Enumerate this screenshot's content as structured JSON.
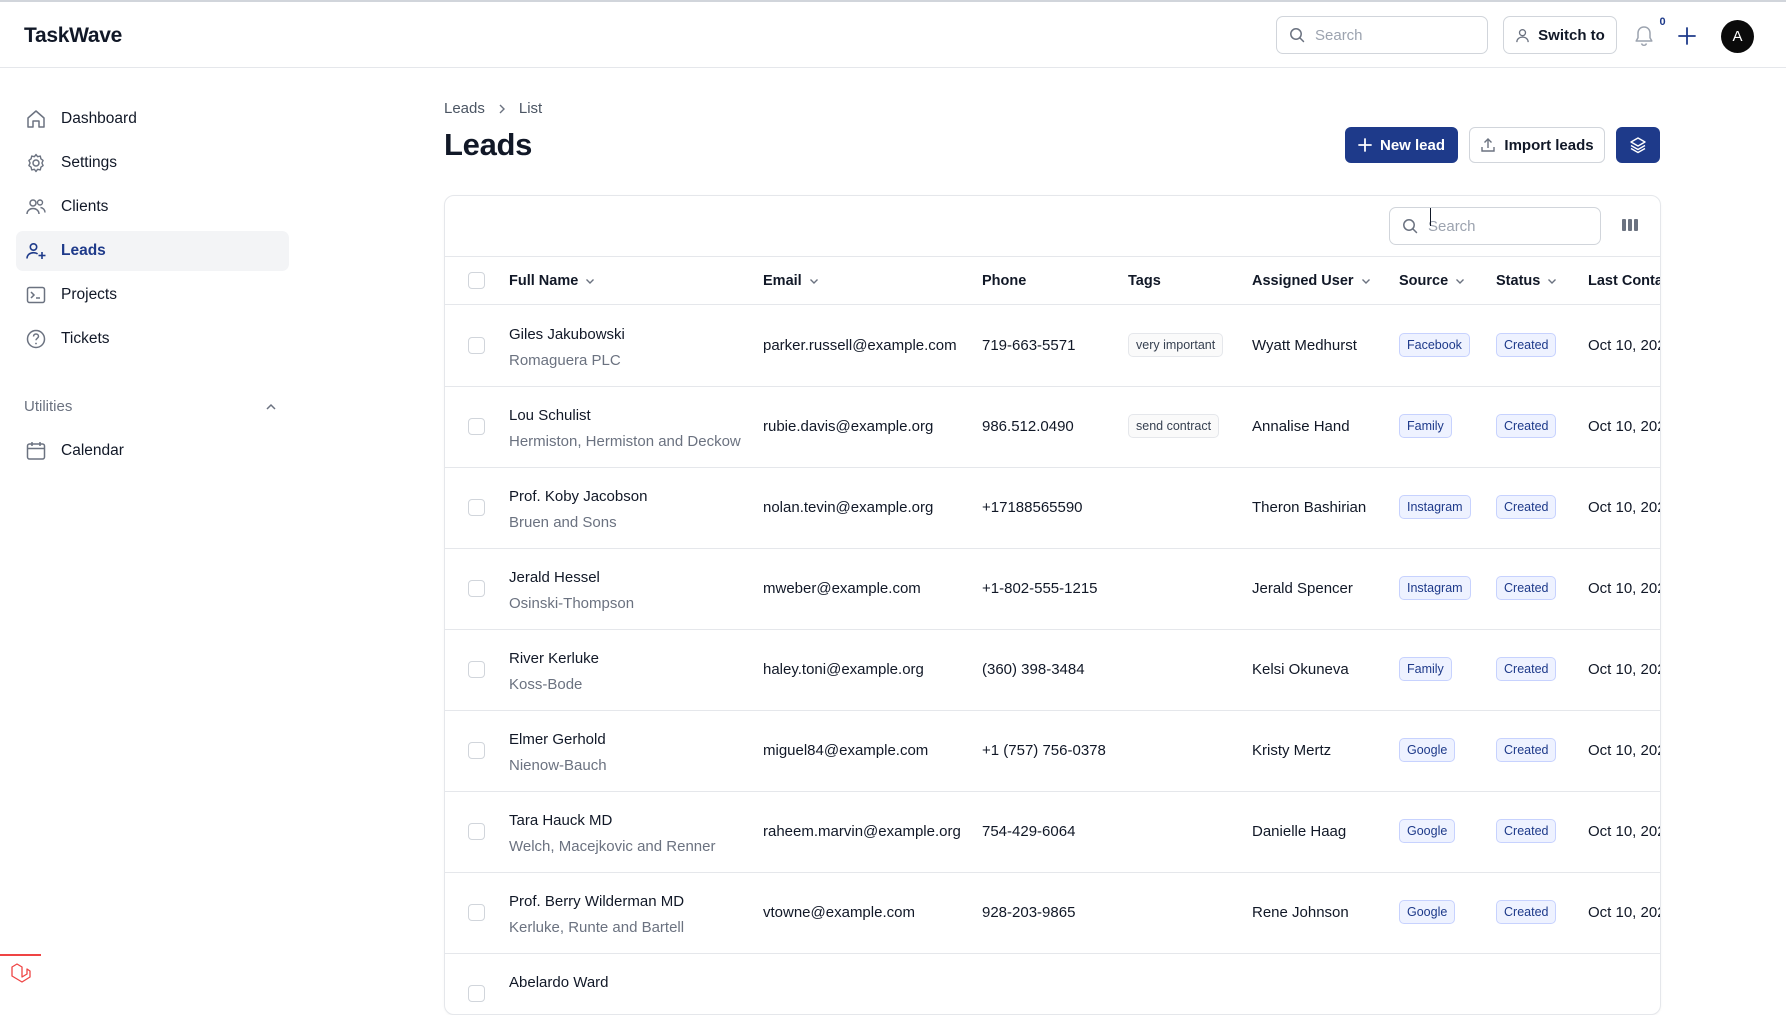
{
  "app": {
    "name": "TaskWave"
  },
  "topbar": {
    "search_placeholder": "Search",
    "switch_label": "Switch to",
    "notification_count": "0",
    "avatar_initial": "A"
  },
  "sidebar": {
    "items": [
      {
        "label": "Dashboard",
        "icon": "home-icon"
      },
      {
        "label": "Settings",
        "icon": "gear-icon"
      },
      {
        "label": "Clients",
        "icon": "users-icon"
      },
      {
        "label": "Leads",
        "icon": "user-plus-icon",
        "active": true
      },
      {
        "label": "Projects",
        "icon": "terminal-icon"
      },
      {
        "label": "Tickets",
        "icon": "question-circle-icon"
      }
    ],
    "section_label": "Utilities",
    "utilities": [
      {
        "label": "Calendar",
        "icon": "calendar-icon"
      }
    ]
  },
  "breadcrumb": [
    "Leads",
    "List"
  ],
  "page": {
    "title": "Leads",
    "new_label": "New lead",
    "import_label": "Import leads"
  },
  "table": {
    "search_placeholder": "Search",
    "columns": [
      "Full Name",
      "Email",
      "Phone",
      "Tags",
      "Assigned User",
      "Source",
      "Status",
      "Last Conta"
    ],
    "rows": [
      {
        "name": "Giles Jakubowski",
        "company": "Romaguera PLC",
        "email": "parker.russell@example.com",
        "phone": "719-663-5571",
        "tag": "very important",
        "user": "Wyatt Medhurst",
        "source": "Facebook",
        "status": "Created",
        "last": "Oct 10, 202"
      },
      {
        "name": "Lou Schulist",
        "company": "Hermiston, Hermiston and Deckow",
        "email": "rubie.davis@example.org",
        "phone": "986.512.0490",
        "tag": "send contract",
        "user": "Annalise Hand",
        "source": "Family",
        "status": "Created",
        "last": "Oct 10, 202"
      },
      {
        "name": "Prof. Koby Jacobson",
        "company": "Bruen and Sons",
        "email": "nolan.tevin@example.org",
        "phone": "+17188565590",
        "tag": "",
        "user": "Theron Bashirian",
        "source": "Instagram",
        "status": "Created",
        "last": "Oct 10, 202"
      },
      {
        "name": "Jerald Hessel",
        "company": "Osinski-Thompson",
        "email": "mweber@example.com",
        "phone": "+1-802-555-1215",
        "tag": "",
        "user": "Jerald Spencer",
        "source": "Instagram",
        "status": "Created",
        "last": "Oct 10, 202"
      },
      {
        "name": "River Kerluke",
        "company": "Koss-Bode",
        "email": "haley.toni@example.org",
        "phone": "(360) 398-3484",
        "tag": "",
        "user": "Kelsi Okuneva",
        "source": "Family",
        "status": "Created",
        "last": "Oct 10, 202"
      },
      {
        "name": "Elmer Gerhold",
        "company": "Nienow-Bauch",
        "email": "miguel84@example.com",
        "phone": "+1 (757) 756-0378",
        "tag": "",
        "user": "Kristy Mertz",
        "source": "Google",
        "status": "Created",
        "last": "Oct 10, 202"
      },
      {
        "name": "Tara Hauck MD",
        "company": "Welch, Macejkovic and Renner",
        "email": "raheem.marvin@example.org",
        "phone": "754-429-6064",
        "tag": "",
        "user": "Danielle Haag",
        "source": "Google",
        "status": "Created",
        "last": "Oct 10, 202"
      },
      {
        "name": "Prof. Berry Wilderman MD",
        "company": "Kerluke, Runte and Bartell",
        "email": "vtowne@example.com",
        "phone": "928-203-9865",
        "tag": "",
        "user": "Rene Johnson",
        "source": "Google",
        "status": "Created",
        "last": "Oct 10, 202"
      },
      {
        "name": "Abelardo Ward",
        "company": "",
        "email": "",
        "phone": "",
        "tag": "",
        "user": "",
        "source": "",
        "status": "",
        "last": ""
      }
    ]
  },
  "colors": {
    "primary": "#1e3a8a",
    "border": "#e5e7eb",
    "muted": "#6b7280"
  }
}
